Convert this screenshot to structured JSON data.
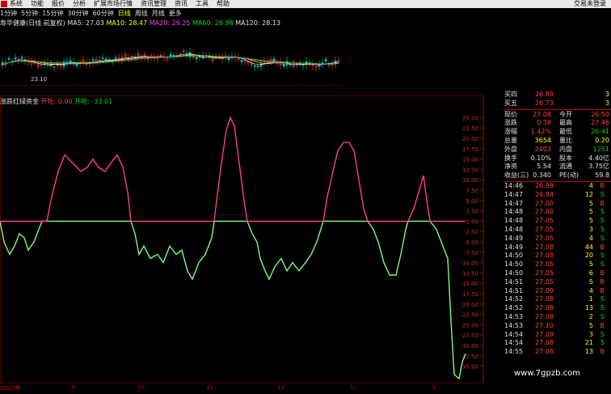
{
  "menu": {
    "items": [
      "系统",
      "功能",
      "报价",
      "分析",
      "扩展市场行情",
      "资讯管理",
      "资讯",
      "工具",
      "帮助"
    ],
    "status": "交易未登录"
  },
  "periods": {
    "items": [
      "1分钟",
      "5分钟",
      "15分钟",
      "30分钟",
      "60分钟",
      "日线",
      "周线",
      "月线",
      "更多"
    ],
    "active": "日线"
  },
  "kline_info": {
    "name": "寿华健康(日线 前复权)",
    "ma5": "MA5: 27.03",
    "ma10": "MA10: 28.47",
    "ma20": "MA20: 29.25",
    "ma60": "MA60: 28.98",
    "ma120": "MA120: 28.13",
    "low_label": "23.10"
  },
  "indicator_info": {
    "name": "涨跌红绿资金",
    "kai": "开吃: 0.00",
    "kai2": "开吃: -33.01"
  },
  "chart_data": {
    "type": "area",
    "title": "",
    "xlabel": "",
    "ylabel": "",
    "ylim": [
      -38,
      28
    ],
    "yticks": [
      25,
      22.5,
      20,
      17.5,
      15,
      12.5,
      10,
      7.5,
      5,
      2.5,
      0,
      -2.5,
      -5,
      -7.5,
      -10,
      -12.5,
      -15,
      -17.5,
      -20,
      -22.5,
      -25,
      -27.5,
      -30,
      -32.5,
      -35
    ],
    "ytick_labels": [
      "25.00",
      "22.50",
      "20.00",
      "17.50",
      "15.00",
      "12.50",
      "10.00",
      "7.50",
      "5.00",
      "2.50",
      "0.00",
      "-2.50",
      "-5.00",
      "-7.50",
      "-10.00",
      "-12.50",
      "-15.00",
      "-17.50",
      "-20.00",
      "-22.50",
      "-25.00",
      "-27.50",
      "-30.00",
      "-32.50",
      "-35.00"
    ],
    "series": [
      {
        "color": "#ff3c96",
        "values": [
          0,
          0,
          0,
          0,
          0,
          0,
          0,
          0,
          0,
          0,
          0,
          0,
          0,
          0,
          1,
          5,
          9,
          12,
          14,
          15,
          13,
          11,
          10,
          11,
          12,
          13,
          14,
          15,
          14,
          13,
          12,
          11,
          10,
          11,
          12,
          13,
          14,
          12,
          10,
          8,
          6,
          4,
          2,
          0,
          0,
          0,
          0,
          0,
          0,
          0,
          0,
          0,
          0,
          0,
          0,
          0,
          0,
          0,
          0,
          0,
          0,
          0,
          0,
          0,
          0,
          0,
          0,
          0,
          0,
          0,
          0,
          0,
          0,
          0,
          0,
          0,
          0,
          0,
          0,
          0,
          0,
          0,
          0,
          0,
          0,
          0,
          0,
          0,
          0,
          0,
          0,
          0,
          0,
          0,
          0,
          0,
          0,
          0,
          0,
          0,
          0,
          0,
          0,
          0,
          0,
          0,
          0,
          0,
          0,
          0,
          0,
          0,
          0,
          0,
          0,
          0,
          0,
          0,
          0,
          0,
          0,
          0,
          0,
          0,
          0,
          0,
          0,
          0,
          0,
          0,
          0,
          0,
          0,
          0,
          0,
          0,
          0,
          0,
          0,
          0,
          0,
          0
        ]
      },
      {
        "color": "#7cff7c",
        "values": [
          0,
          -3,
          -6,
          -8,
          -7,
          -5,
          -4,
          -6,
          -8,
          -7,
          -5,
          -3,
          -2,
          -1,
          0,
          0,
          0,
          0,
          0,
          0,
          0,
          0,
          0,
          0,
          0,
          0,
          0,
          0,
          0,
          0,
          0,
          0,
          0,
          0,
          0,
          0,
          0,
          0,
          0,
          0,
          0,
          0,
          0,
          0,
          0,
          -3,
          -6,
          -8,
          -10,
          -9,
          -7,
          -5,
          -6,
          -8,
          -9,
          -7,
          -6,
          -8,
          -10,
          -12,
          -14,
          -11,
          -8,
          -5,
          -3,
          0,
          0,
          0,
          0,
          0,
          0,
          0,
          0,
          0,
          0,
          0,
          0,
          0,
          0,
          0,
          0,
          0,
          0,
          0,
          0,
          0,
          0,
          0,
          0,
          0,
          0,
          0,
          0,
          0,
          0,
          0,
          0,
          0,
          0,
          0,
          0,
          0,
          0,
          0,
          0,
          0,
          0,
          0,
          0,
          0,
          0,
          0,
          0,
          0,
          0,
          0,
          0,
          0,
          0,
          0,
          0,
          0,
          0,
          0,
          0,
          0,
          0,
          0,
          0,
          0,
          0,
          0,
          0,
          0,
          0,
          0,
          0,
          0,
          0,
          0,
          0,
          0,
          0,
          0
        ]
      },
      {
        "color": "#ff3c96",
        "name": "",
        "values": []
      }
    ],
    "red_segments": [
      [
        [
          0,
          0
        ],
        [
          58,
          0
        ],
        [
          64,
          6
        ],
        [
          72,
          12
        ],
        [
          80,
          16
        ],
        [
          90,
          14
        ],
        [
          100,
          12
        ],
        [
          108,
          13
        ],
        [
          115,
          15
        ],
        [
          122,
          13
        ],
        [
          130,
          12
        ],
        [
          137,
          14
        ],
        [
          145,
          16
        ],
        [
          152,
          13
        ],
        [
          158,
          7
        ],
        [
          162,
          0
        ],
        [
          265,
          0
        ],
        [
          268,
          5
        ],
        [
          274,
          14
        ],
        [
          280,
          22
        ],
        [
          285,
          25
        ],
        [
          290,
          23
        ],
        [
          296,
          14
        ],
        [
          302,
          5
        ],
        [
          306,
          0
        ],
        [
          400,
          0
        ],
        [
          405,
          6
        ],
        [
          412,
          12
        ],
        [
          418,
          17
        ],
        [
          425,
          19
        ],
        [
          432,
          19
        ],
        [
          438,
          17
        ],
        [
          444,
          10
        ],
        [
          450,
          3
        ],
        [
          455,
          0
        ],
        [
          505,
          0
        ],
        [
          512,
          3
        ],
        [
          518,
          7
        ],
        [
          524,
          11
        ],
        [
          528,
          5
        ],
        [
          532,
          0
        ],
        [
          576,
          0
        ]
      ]
    ],
    "green_segments": [
      [
        [
          0,
          0
        ],
        [
          5,
          -5
        ],
        [
          12,
          -8
        ],
        [
          18,
          -6
        ],
        [
          24,
          -3
        ],
        [
          30,
          -4
        ],
        [
          35,
          -7
        ],
        [
          42,
          -5
        ],
        [
          52,
          0
        ],
        [
          58,
          0
        ],
        [
          162,
          0
        ],
        [
          167,
          -3
        ],
        [
          172,
          -8
        ],
        [
          178,
          -6
        ],
        [
          186,
          -9
        ],
        [
          195,
          -8
        ],
        [
          202,
          -10
        ],
        [
          210,
          -6
        ],
        [
          218,
          -8
        ],
        [
          225,
          -7
        ],
        [
          232,
          -12
        ],
        [
          238,
          -14
        ],
        [
          246,
          -10
        ],
        [
          254,
          -8
        ],
        [
          262,
          -4
        ],
        [
          265,
          0
        ],
        [
          306,
          0
        ],
        [
          312,
          -3
        ],
        [
          318,
          -5
        ],
        [
          322,
          -9
        ],
        [
          328,
          -12
        ],
        [
          333,
          -14
        ],
        [
          340,
          -11
        ],
        [
          348,
          -9
        ],
        [
          355,
          -12
        ],
        [
          362,
          -10
        ],
        [
          370,
          -12
        ],
        [
          378,
          -10
        ],
        [
          385,
          -8
        ],
        [
          392,
          -5
        ],
        [
          400,
          0
        ],
        [
          455,
          0
        ],
        [
          462,
          -2
        ],
        [
          468,
          -5
        ],
        [
          475,
          -10
        ],
        [
          482,
          -13
        ],
        [
          490,
          -13
        ],
        [
          496,
          -8
        ],
        [
          502,
          -2
        ],
        [
          505,
          0
        ],
        [
          532,
          0
        ],
        [
          540,
          -2
        ],
        [
          546,
          -5
        ],
        [
          550,
          -7
        ],
        [
          554,
          -9
        ],
        [
          558,
          -24
        ],
        [
          562,
          -37
        ],
        [
          568,
          -38
        ],
        [
          572,
          -34
        ],
        [
          576,
          -32
        ]
      ]
    ]
  },
  "quote": {
    "sell": [
      {
        "label": "买四",
        "price": "26.89",
        "vol": "3"
      },
      {
        "label": "买五",
        "price": "26.73",
        "vol": "3"
      }
    ],
    "stats": [
      {
        "l1": "现价",
        "v1": "27.08",
        "c1": "red",
        "l2": "今开",
        "v2": "26.50",
        "c2": "red"
      },
      {
        "l1": "涨跌",
        "v1": "0.38",
        "c1": "red",
        "l2": "最高",
        "v2": "27.46",
        "c2": "red"
      },
      {
        "l1": "涨幅",
        "v1": "1.42%",
        "c1": "red",
        "l2": "最低",
        "v2": "26.41",
        "c2": "green"
      },
      {
        "l1": "总量",
        "v1": "3654",
        "c1": "yellow",
        "l2": "量比",
        "v2": "0.20",
        "c2": "yellow"
      },
      {
        "l1": "外盘",
        "v1": "2403",
        "c1": "red",
        "l2": "内盘",
        "v2": "1251",
        "c2": "green"
      },
      {
        "l1": "换手",
        "v1": "0.10%",
        "c1": "white",
        "l2": "股本",
        "v2": "4.40亿",
        "c2": "white"
      },
      {
        "l1": "净资",
        "v1": "5.54",
        "c1": "white",
        "l2": "流通",
        "v2": "3.75亿",
        "c2": "white"
      },
      {
        "l1": "收益(三)",
        "v1": "0.340",
        "c1": "white",
        "l2": "PE(动)",
        "v2": "59.8",
        "c2": "white"
      }
    ],
    "ticks": [
      {
        "t": "14:46",
        "p": "26.99",
        "v": "4",
        "s": "B"
      },
      {
        "t": "14:47",
        "p": "26.94",
        "v": "12",
        "s": "S"
      },
      {
        "t": "14:47",
        "p": "27.00",
        "v": "5",
        "s": "B"
      },
      {
        "t": "14:48",
        "p": "27.00",
        "v": "5",
        "s": "S"
      },
      {
        "t": "14:48",
        "p": "27.05",
        "v": "5",
        "s": "S"
      },
      {
        "t": "14:48",
        "p": "27.05",
        "v": "3",
        "s": "S"
      },
      {
        "t": "14:49",
        "p": "27.05",
        "v": "4",
        "s": "S"
      },
      {
        "t": "14:49",
        "p": "27.08",
        "v": "44",
        "s": "B"
      },
      {
        "t": "14:50",
        "p": "27.08",
        "v": "20",
        "s": "S"
      },
      {
        "t": "14:50",
        "p": "27.05",
        "v": "5",
        "s": "S"
      },
      {
        "t": "14:50",
        "p": "27.05",
        "v": "6",
        "s": "B"
      },
      {
        "t": "14:51",
        "p": "27.05",
        "v": "5",
        "s": "B"
      },
      {
        "t": "14:51",
        "p": "27.09",
        "v": "4",
        "s": "B"
      },
      {
        "t": "14:52",
        "p": "27.08",
        "v": "1",
        "s": "S"
      },
      {
        "t": "14:52",
        "p": "27.08",
        "v": "13",
        "s": "S"
      },
      {
        "t": "14:53",
        "p": "27.08",
        "v": "2",
        "s": "S"
      },
      {
        "t": "14:53",
        "p": "27.10",
        "v": "5",
        "s": "B"
      },
      {
        "t": "14:54",
        "p": "27.09",
        "v": "3",
        "s": "S"
      },
      {
        "t": "14:54",
        "p": "27.08",
        "v": "21",
        "s": "S"
      },
      {
        "t": "14:55",
        "p": "27.08",
        "v": "13",
        "s": "B"
      }
    ]
  },
  "date_axis": [
    "2017年",
    "8",
    "9",
    "10",
    "11",
    "12",
    "1",
    "2"
  ],
  "watermark": "www.7gpzb.com"
}
